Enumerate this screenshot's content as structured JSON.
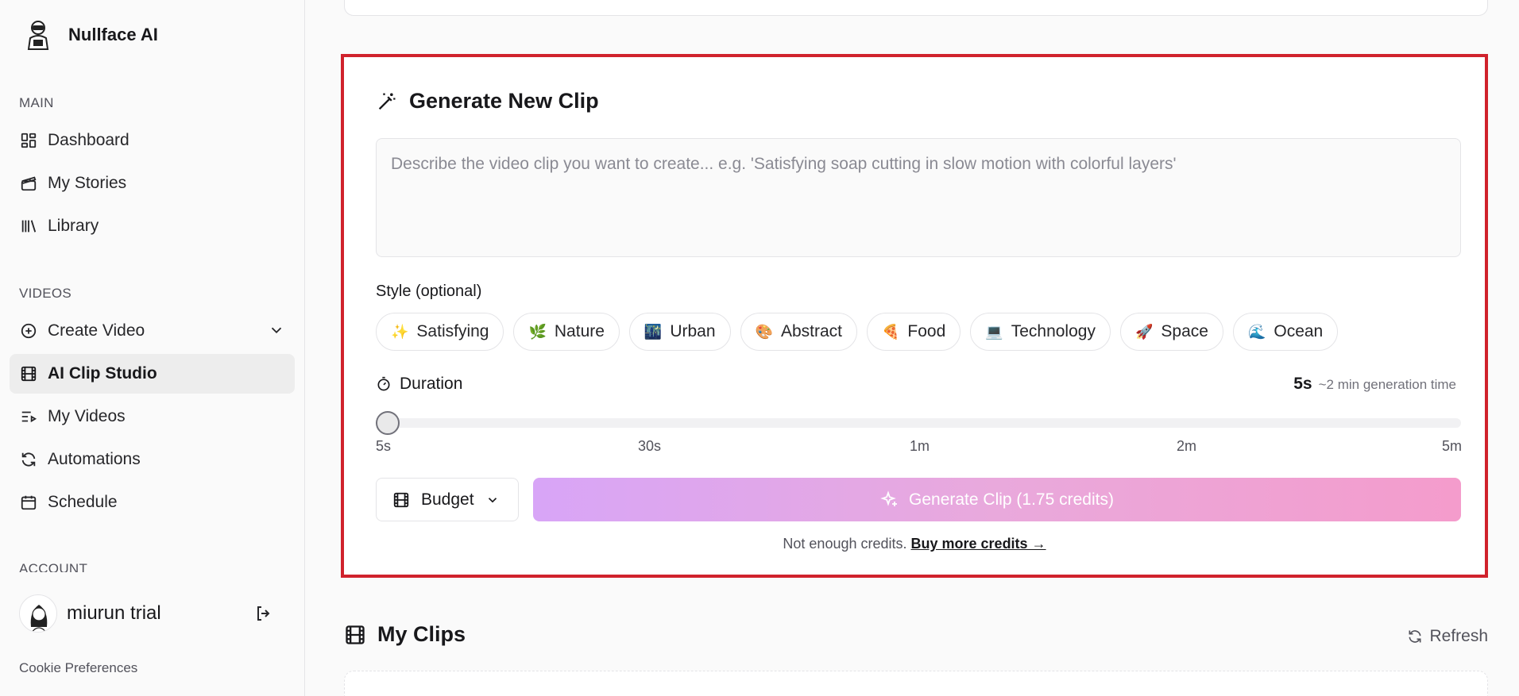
{
  "app": {
    "name": "Nullface AI"
  },
  "sidebar": {
    "sections": {
      "main": "MAIN",
      "videos": "VIDEOS",
      "account": "ACCOUNT"
    },
    "items": [
      {
        "label": "Dashboard",
        "icon": "dashboard-icon"
      },
      {
        "label": "My Stories",
        "icon": "clapper-icon"
      },
      {
        "label": "Library",
        "icon": "library-icon"
      },
      {
        "label": "Create Video",
        "icon": "plus-circle-icon"
      },
      {
        "label": "AI Clip Studio",
        "icon": "film-icon",
        "active": true
      },
      {
        "label": "My Videos",
        "icon": "list-video-icon"
      },
      {
        "label": "Automations",
        "icon": "refresh-icon"
      },
      {
        "label": "Schedule",
        "icon": "calendar-icon"
      }
    ],
    "user": {
      "name": "miurun trial"
    },
    "cookie": "Cookie Preferences"
  },
  "generate": {
    "title": "Generate New Clip",
    "prompt_placeholder": "Describe the video clip you want to create... e.g. 'Satisfying soap cutting in slow motion with colorful layers'",
    "style_label": "Style (optional)",
    "styles": [
      {
        "emoji": "✨",
        "label": "Satisfying"
      },
      {
        "emoji": "🌿",
        "label": "Nature"
      },
      {
        "emoji": "🌃",
        "label": "Urban"
      },
      {
        "emoji": "🎨",
        "label": "Abstract"
      },
      {
        "emoji": "🍕",
        "label": "Food"
      },
      {
        "emoji": "💻",
        "label": "Technology"
      },
      {
        "emoji": "🚀",
        "label": "Space"
      },
      {
        "emoji": "🌊",
        "label": "Ocean"
      }
    ],
    "duration_label": "Duration",
    "duration_value": "5s",
    "duration_note": "~2 min generation time",
    "slider_fraction": 0,
    "ticks": [
      "5s",
      "30s",
      "1m",
      "2m",
      "5m"
    ],
    "quality": "Budget",
    "button": "Generate Clip (1.75 credits)",
    "credits_note": "Not enough credits.",
    "credits_link": "Buy more credits →"
  },
  "clips": {
    "title": "My Clips",
    "refresh": "Refresh"
  },
  "colors": {
    "highlight": "#d0222c",
    "gradient_start": "#d8a5f7",
    "gradient_end": "#f49ccc"
  }
}
